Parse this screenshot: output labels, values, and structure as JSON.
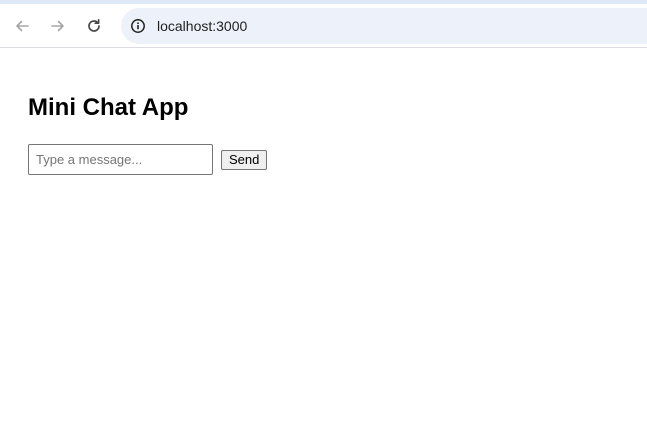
{
  "browser": {
    "url": "localhost:3000",
    "icons": {
      "back": "arrow-left-icon",
      "forward": "arrow-right-icon",
      "reload": "reload-icon",
      "site_info": "info-icon"
    },
    "colors": {
      "omnibox_bg": "#edf2fa",
      "nav_disabled": "#a5a5a5",
      "nav_active": "#474747"
    }
  },
  "app": {
    "title": "Mini Chat App",
    "message_input": {
      "value": "",
      "placeholder": "Type a message..."
    },
    "send_label": "Send"
  }
}
